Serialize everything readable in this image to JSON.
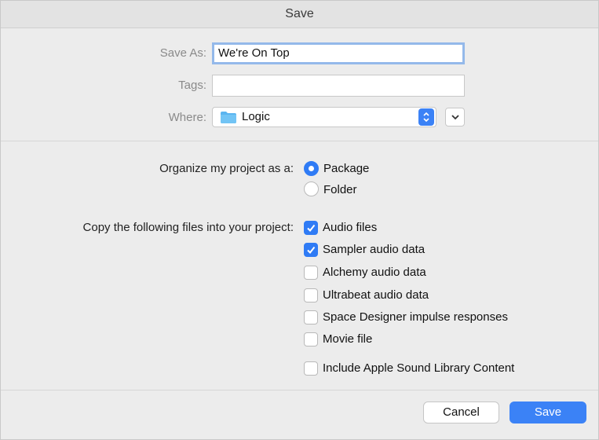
{
  "window": {
    "title": "Save"
  },
  "form": {
    "save_as_label": "Save As:",
    "save_as_value": "We're On Top",
    "tags_label": "Tags:",
    "tags_value": "",
    "where_label": "Where:",
    "where_value": "Logic",
    "where_icon": "folder-icon"
  },
  "organize": {
    "label": "Organize my project as a:",
    "options": [
      {
        "label": "Package",
        "selected": true
      },
      {
        "label": "Folder",
        "selected": false
      }
    ]
  },
  "copy_files": {
    "label": "Copy the following files into your project:",
    "options": [
      {
        "label": "Audio files",
        "checked": true
      },
      {
        "label": "Sampler audio data",
        "checked": true
      },
      {
        "label": "Alchemy audio data",
        "checked": false
      },
      {
        "label": "Ultrabeat audio data",
        "checked": false
      },
      {
        "label": "Space Designer impulse responses",
        "checked": false
      },
      {
        "label": "Movie file",
        "checked": false
      }
    ],
    "extra_option": {
      "label": "Include Apple Sound Library Content",
      "checked": false
    }
  },
  "buttons": {
    "cancel_label": "Cancel",
    "save_label": "Save"
  },
  "colors": {
    "accent": "#2f7bf5",
    "focus_ring": "#94b9ea",
    "folder": "#5bb5f0"
  }
}
